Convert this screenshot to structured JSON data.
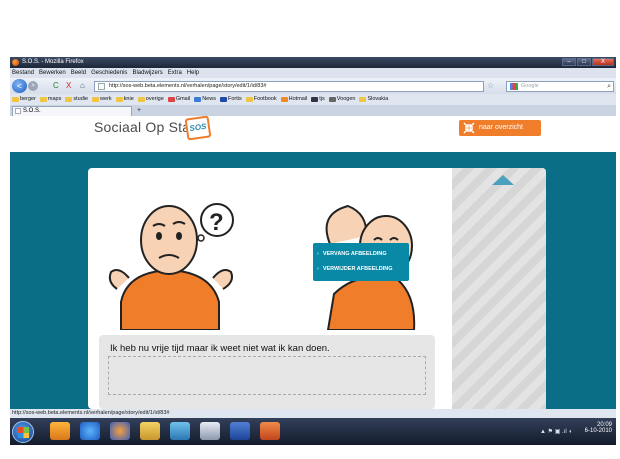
{
  "window": {
    "title": "S.O.S. - Mozilla Firefox",
    "controls": [
      "–",
      "□",
      "X"
    ]
  },
  "menu": [
    "Bestand",
    "Bewerken",
    "Beeld",
    "Geschiedenis",
    "Bladwijzers",
    "Extra",
    "Help"
  ],
  "nav": {
    "back": "<",
    "forward": ">",
    "reload": "C",
    "stop": "X",
    "home": "⌂",
    "url": "http://sos-web.beta.elements.nl/verhalen/page/story/edit/1/id/83#",
    "search_engine": "Google",
    "star": "☆"
  },
  "bookmarks": [
    {
      "label": "berger",
      "icon": "folder-icon"
    },
    {
      "label": "maps",
      "icon": "folder-icon"
    },
    {
      "label": "studie",
      "icon": "folder-icon"
    },
    {
      "label": "werk",
      "icon": "folder-icon"
    },
    {
      "label": "knie",
      "icon": "folder-icon"
    },
    {
      "label": "overige",
      "icon": "folder-icon"
    },
    {
      "label": "Gmail",
      "icon": "mail-icon"
    },
    {
      "label": "News",
      "icon": "news-icon"
    },
    {
      "label": "Fortis",
      "icon": "bank-icon"
    },
    {
      "label": "Footbook",
      "icon": "folder-icon"
    },
    {
      "label": "Hotmail",
      "icon": "mail-icon"
    },
    {
      "label": "tjs",
      "icon": "link-icon"
    },
    {
      "label": "Voogen",
      "icon": "link-icon"
    },
    {
      "label": "Slovakia",
      "icon": "folder-icon"
    }
  ],
  "tabs": [
    {
      "label": "S.O.S."
    }
  ],
  "new_tab": "+",
  "header": {
    "logo_text": "Sociaal Op Stap",
    "logo_badge": "SOS",
    "overview_button": "naar overzicht"
  },
  "image_menu": {
    "items": [
      "VERVANG AFBEELDING",
      "VERWIJDER AFBEELDING"
    ]
  },
  "story": {
    "text": "Ik heb nu vrije tijd maar ik weet niet wat ik kan doen."
  },
  "statusbar": {
    "text": "http://sos-web.beta.elements.nl/verhalen/page/story/edit/1/id/83#"
  },
  "taskbar": {
    "time": "20:09",
    "date": "6-10-2010",
    "tray": "▲ ⚑ ▣ .ıl ◖"
  },
  "colors": {
    "page_background": "#0a6e86",
    "accent_orange": "#f07d2a",
    "menu_teal": "#0a89a6"
  }
}
